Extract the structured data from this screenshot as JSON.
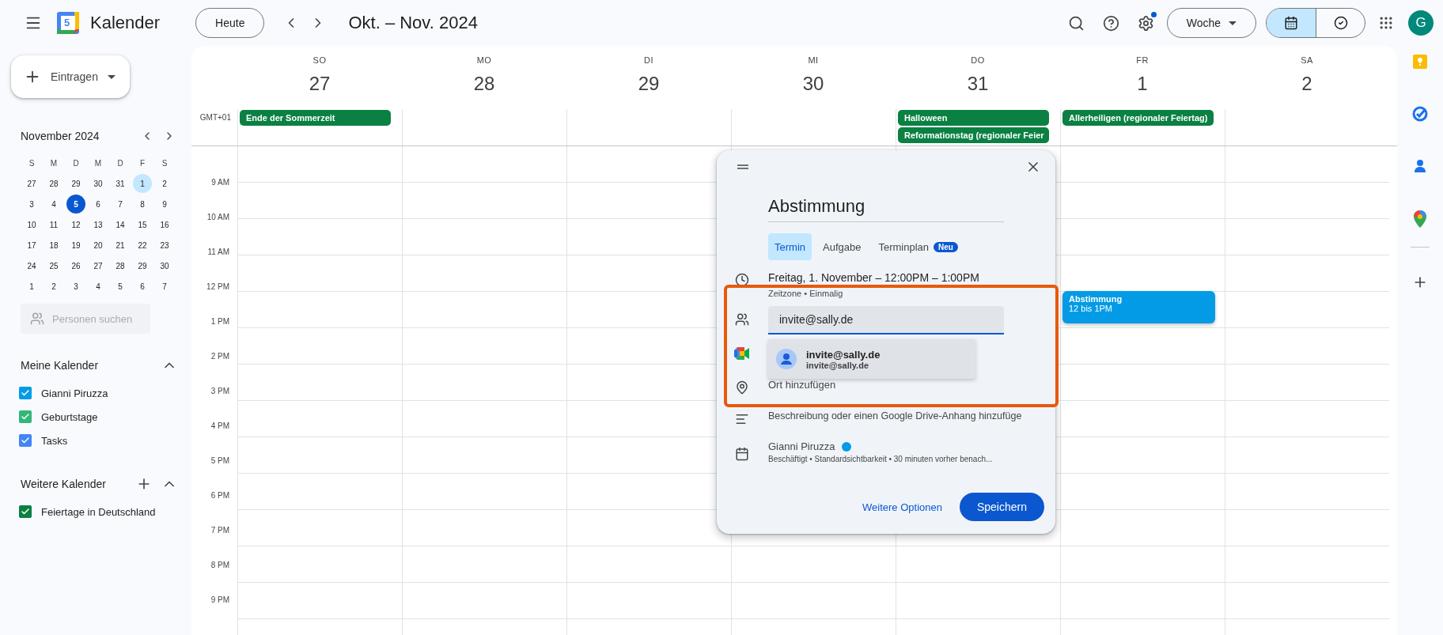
{
  "header": {
    "app_name": "Kalender",
    "logo_day": "5",
    "today_button": "Heute",
    "range_title": "Okt. – Nov. 2024",
    "settings_badge": true,
    "view_select": "Woche",
    "view_toggle": [
      {
        "kind": "calendar",
        "selected": true
      },
      {
        "kind": "tasks",
        "selected": false
      }
    ],
    "avatar": "G"
  },
  "sidebar": {
    "create_button": "Eintragen",
    "mini_calendar": {
      "title": "November 2024",
      "weekdays": [
        "S",
        "M",
        "D",
        "M",
        "D",
        "F",
        "S"
      ],
      "weeks": [
        [
          {
            "d": "27",
            "today": false,
            "selected": false
          },
          {
            "d": "28",
            "today": false,
            "selected": false
          },
          {
            "d": "29",
            "today": false,
            "selected": false
          },
          {
            "d": "30",
            "today": false,
            "selected": false
          },
          {
            "d": "31",
            "today": false,
            "selected": false
          },
          {
            "d": "1",
            "today": false,
            "selected": true
          },
          {
            "d": "2",
            "today": false,
            "selected": false
          }
        ],
        [
          {
            "d": "3",
            "today": false,
            "selected": false
          },
          {
            "d": "4",
            "today": false,
            "selected": false
          },
          {
            "d": "5",
            "today": true,
            "selected": false
          },
          {
            "d": "6",
            "today": false,
            "selected": false
          },
          {
            "d": "7",
            "today": false,
            "selected": false
          },
          {
            "d": "8",
            "today": false,
            "selected": false
          },
          {
            "d": "9",
            "today": false,
            "selected": false
          }
        ],
        [
          {
            "d": "10",
            "today": false,
            "selected": false
          },
          {
            "d": "11",
            "today": false,
            "selected": false
          },
          {
            "d": "12",
            "today": false,
            "selected": false
          },
          {
            "d": "13",
            "today": false,
            "selected": false
          },
          {
            "d": "14",
            "today": false,
            "selected": false
          },
          {
            "d": "15",
            "today": false,
            "selected": false
          },
          {
            "d": "16",
            "today": false,
            "selected": false
          }
        ],
        [
          {
            "d": "17",
            "today": false,
            "selected": false
          },
          {
            "d": "18",
            "today": false,
            "selected": false
          },
          {
            "d": "19",
            "today": false,
            "selected": false
          },
          {
            "d": "20",
            "today": false,
            "selected": false
          },
          {
            "d": "21",
            "today": false,
            "selected": false
          },
          {
            "d": "22",
            "today": false,
            "selected": false
          },
          {
            "d": "23",
            "today": false,
            "selected": false
          }
        ],
        [
          {
            "d": "24",
            "today": false,
            "selected": false
          },
          {
            "d": "25",
            "today": false,
            "selected": false
          },
          {
            "d": "26",
            "today": false,
            "selected": false
          },
          {
            "d": "27",
            "today": false,
            "selected": false
          },
          {
            "d": "28",
            "today": false,
            "selected": false
          },
          {
            "d": "29",
            "today": false,
            "selected": false
          },
          {
            "d": "30",
            "today": false,
            "selected": false
          }
        ],
        [
          {
            "d": "1",
            "today": false,
            "selected": false
          },
          {
            "d": "2",
            "today": false,
            "selected": false
          },
          {
            "d": "3",
            "today": false,
            "selected": false
          },
          {
            "d": "4",
            "today": false,
            "selected": false
          },
          {
            "d": "5",
            "today": false,
            "selected": false
          },
          {
            "d": "6",
            "today": false,
            "selected": false
          },
          {
            "d": "7",
            "today": false,
            "selected": false
          }
        ]
      ]
    },
    "people_search": {
      "placeholder": "Personen suchen"
    },
    "sections": [
      {
        "title": "Meine Kalender",
        "expanded": true,
        "can_add": false,
        "items": [
          {
            "label": "Gianni Piruzza",
            "checked": true,
            "color": "#039be5"
          },
          {
            "label": "Geburtstage",
            "checked": true,
            "color": "#33b679"
          },
          {
            "label": "Tasks",
            "checked": true,
            "color": "#4285f4"
          }
        ]
      },
      {
        "title": "Weitere Kalender",
        "expanded": true,
        "can_add": true,
        "items": [
          {
            "label": "Feiertage in Deutschland",
            "checked": true,
            "color": "#0b8043"
          }
        ]
      }
    ]
  },
  "week": {
    "timezone": "GMT+01",
    "days": [
      {
        "weekday": "SO",
        "date": "27",
        "all_day": [
          {
            "title": "Ende der Sommerzeit"
          }
        ]
      },
      {
        "weekday": "MO",
        "date": "28"
      },
      {
        "weekday": "DI",
        "date": "29"
      },
      {
        "weekday": "MI",
        "date": "30"
      },
      {
        "weekday": "DO",
        "date": "31",
        "all_day": [
          {
            "title": "Halloween"
          },
          {
            "title": "Reformationstag (regionaler Feier"
          }
        ]
      },
      {
        "weekday": "FR",
        "date": "1",
        "all_day": [
          {
            "title": "Allerheiligen (regionaler Feiertag)"
          }
        ],
        "events": [
          {
            "title": "Abstimmung",
            "time": "12 bis 1PM"
          }
        ]
      },
      {
        "weekday": "SA",
        "date": "2"
      }
    ],
    "hours": [
      "9 AM",
      "10 AM",
      "11 AM",
      "12 PM",
      "1 PM",
      "2 PM",
      "3 PM",
      "4 PM",
      "5 PM",
      "6 PM",
      "7 PM",
      "8 PM",
      "9 PM"
    ]
  },
  "dialog": {
    "title": "Abstimmung",
    "tabs": [
      {
        "label": "Termin",
        "selected": true
      },
      {
        "label": "Aufgabe",
        "selected": false
      },
      {
        "label": "Terminplan",
        "selected": false,
        "badge": "Neu"
      }
    ],
    "date_line": "Freitag, 1. November – 12:00PM – 1:00PM",
    "date_sub": "Zeitzone • Einmalig",
    "guest_field": {
      "value": "invite@sally.de"
    },
    "suggestion": {
      "name": "invite@sally.de",
      "email": "invite@sally.de"
    },
    "location": "Ort hinzufügen",
    "description": "Beschreibung oder einen Google Drive-Anhang hinzufüge",
    "calendar": {
      "name": "Gianni Piruzza",
      "color": "#039be5",
      "details": "Beschäftigt • Standardsichtbarkeit •  30 minuten vorher benach..."
    },
    "more_options": "Weitere Optionen",
    "save_button": "Speichern"
  }
}
